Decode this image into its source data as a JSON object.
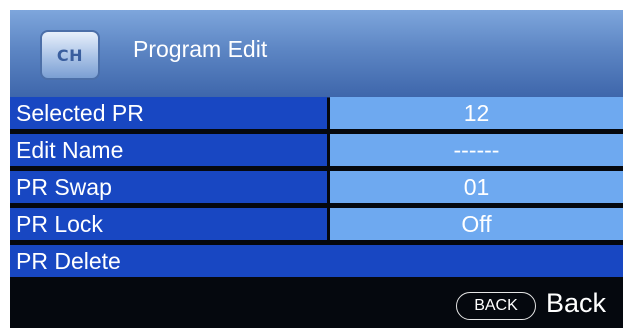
{
  "header": {
    "badge_text": "CH",
    "title": "Program Edit"
  },
  "menu": {
    "rows": [
      {
        "label": "Selected PR",
        "value": "12"
      },
      {
        "label": "Edit Name",
        "value": "------"
      },
      {
        "label": "PR Swap",
        "value": "01"
      },
      {
        "label": "PR Lock",
        "value": "Off"
      },
      {
        "label": "PR Delete"
      }
    ]
  },
  "footer": {
    "back_key": "BACK",
    "back_label": "Back"
  },
  "colors": {
    "label_background": "#1847c2",
    "value_background": "#6ea9f0",
    "header_background": "#5d86c4",
    "screen_background": "#05080e"
  }
}
